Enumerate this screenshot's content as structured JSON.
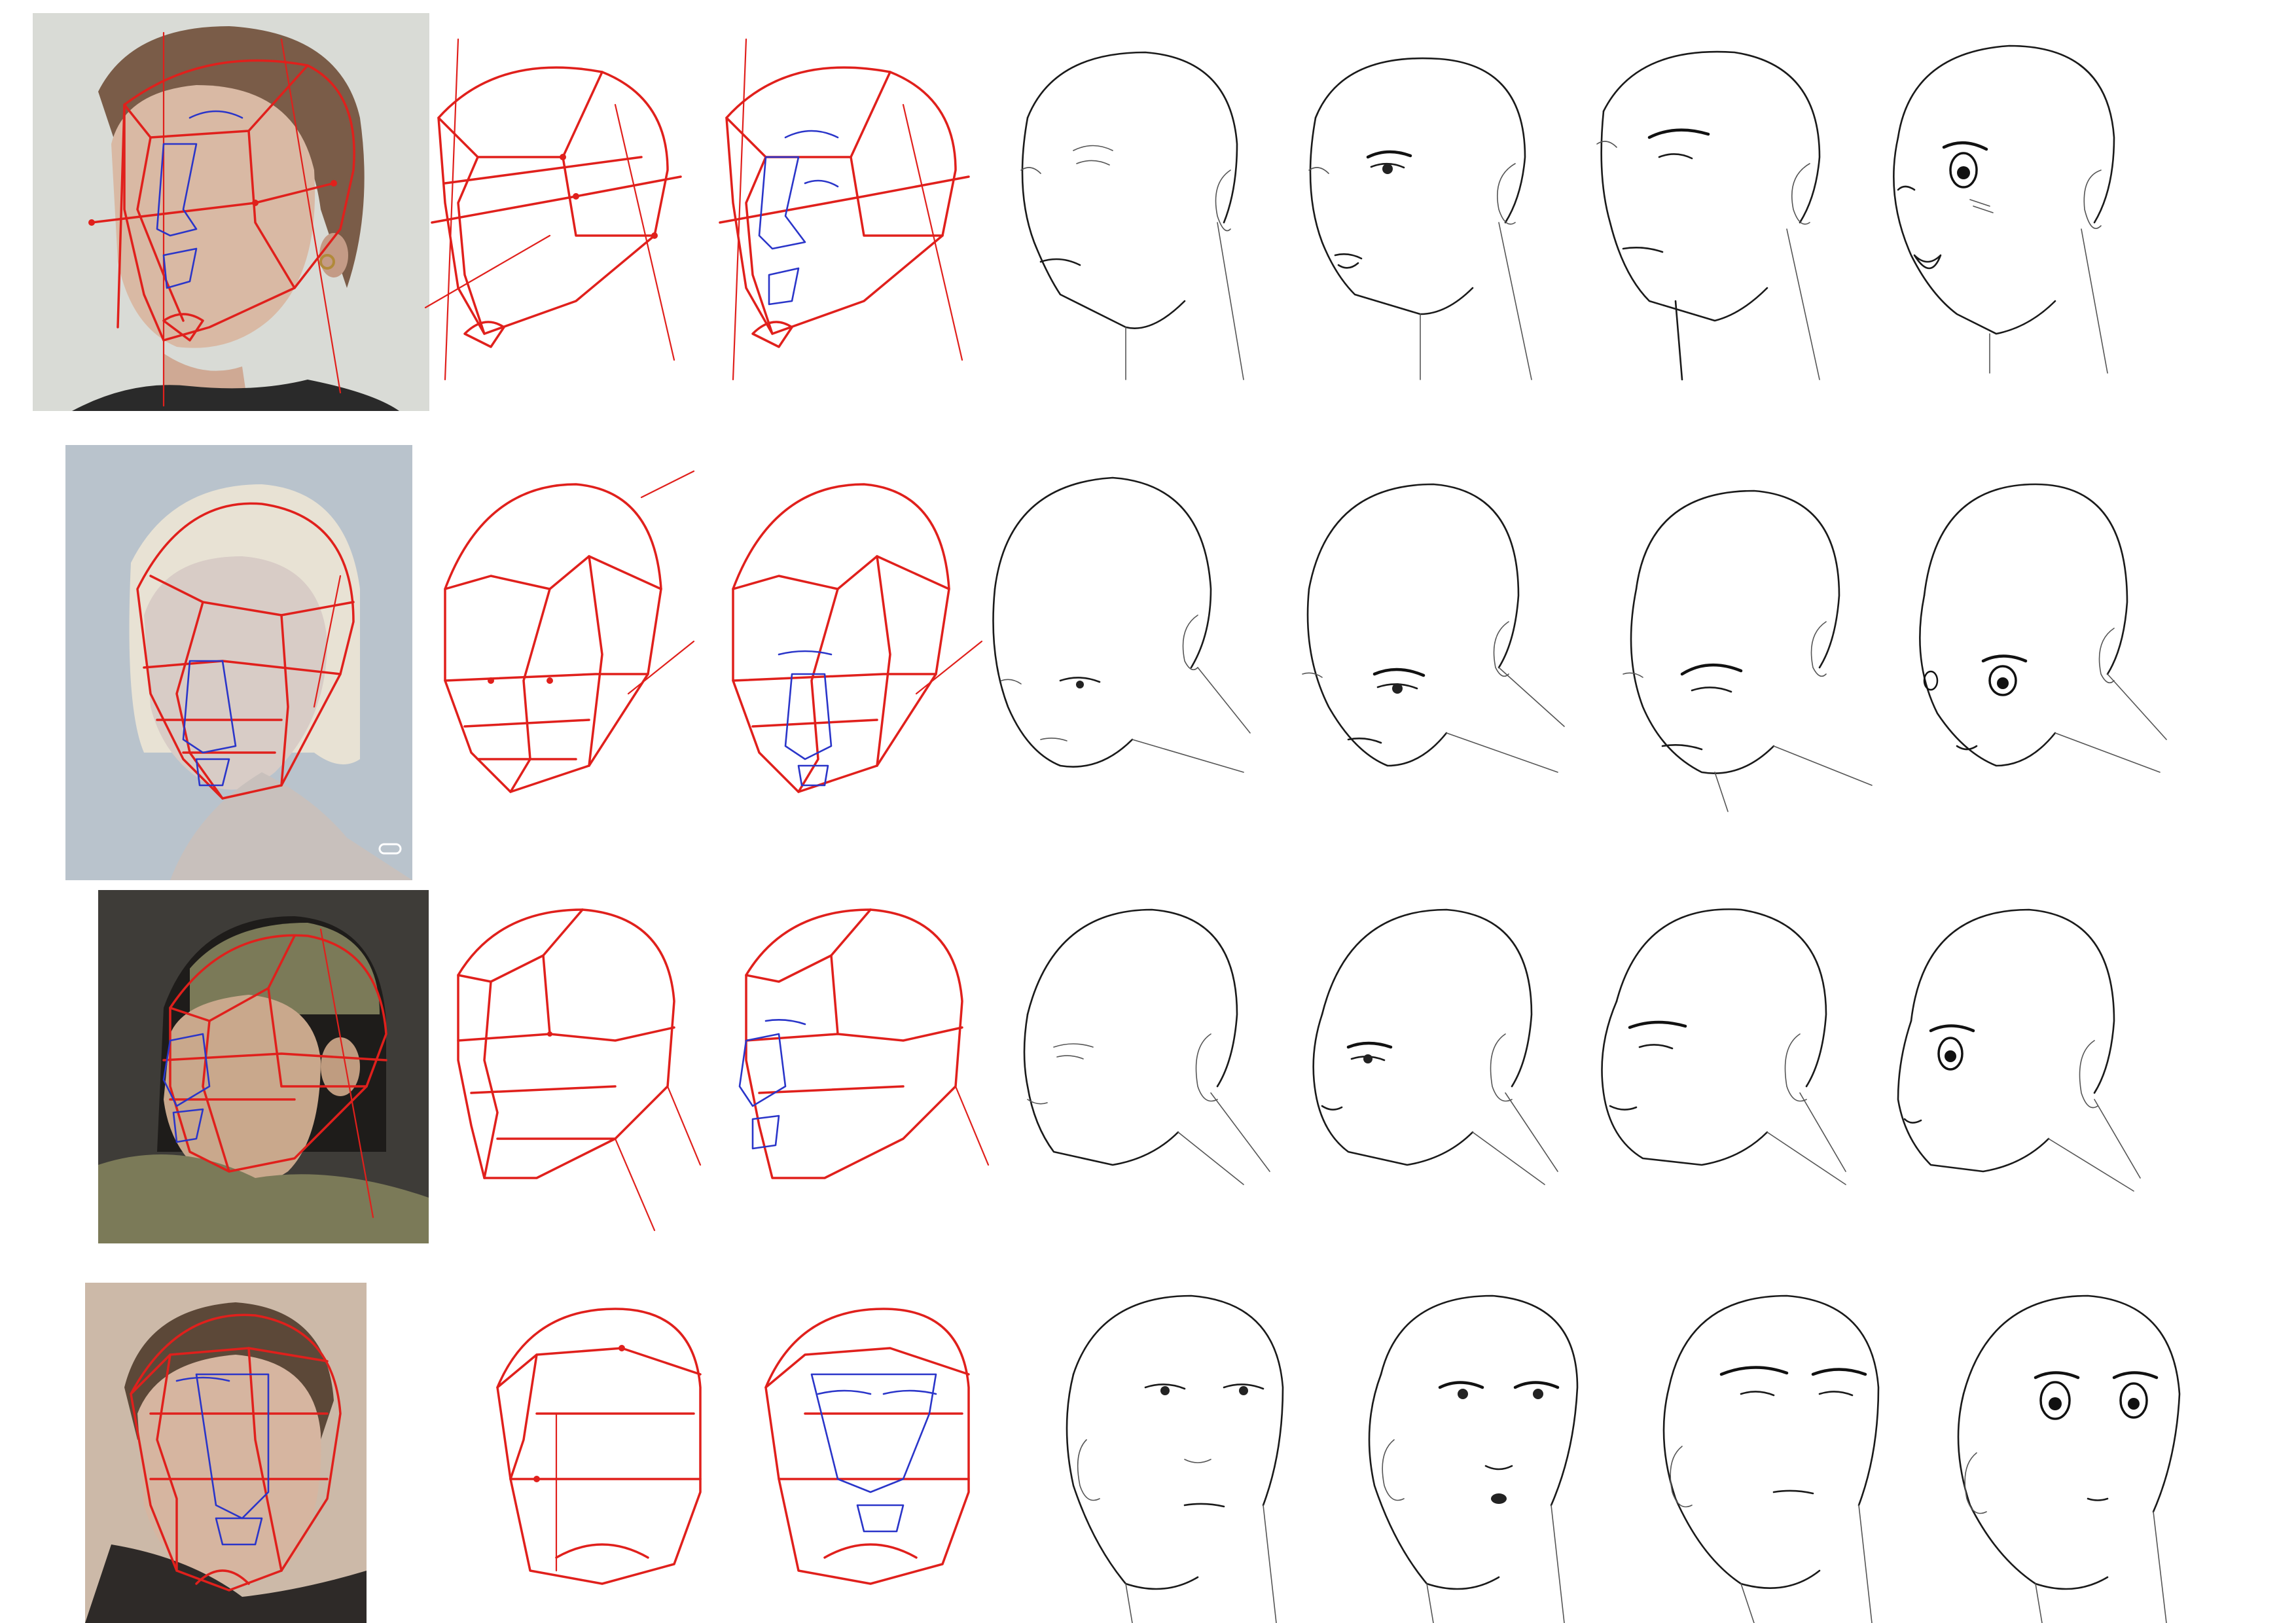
{
  "sheet": {
    "background": "#ffffff",
    "construction_color": "#e0201c",
    "feature_color": "#2a35c9",
    "ink_color": "#1a1a1a"
  },
  "rows": [
    {
      "photo_bg": "#d9dbd6",
      "hair_color": "#7a5c48",
      "skin_color": "#d9b9a4",
      "cloth_color": "#2a2a2a",
      "view": "three-quarter-left",
      "styles": [
        "realistic",
        "feminine",
        "masculine",
        "anime"
      ]
    },
    {
      "photo_bg": "#b9c3cc",
      "hair_color": "#e8e2d4",
      "skin_color": "#d8ccc6",
      "cloth_color": "#c8c0bc",
      "view": "three-quarter-down-left",
      "styles": [
        "realistic",
        "feminine",
        "masculine",
        "anime"
      ]
    },
    {
      "photo_bg": "#3e3c38",
      "hair_color": "#1e1c1a",
      "skin_color": "#c9a88c",
      "cloth_color": "#7b7a58",
      "view": "profile-left",
      "styles": [
        "realistic",
        "feminine",
        "masculine",
        "anime"
      ]
    },
    {
      "photo_bg": "#ccb9a8",
      "hair_color": "#5c4838",
      "skin_color": "#d6b5a0",
      "cloth_color": "#2e2a28",
      "view": "looking-up",
      "styles": [
        "realistic",
        "feminine",
        "masculine",
        "anime"
      ]
    }
  ]
}
